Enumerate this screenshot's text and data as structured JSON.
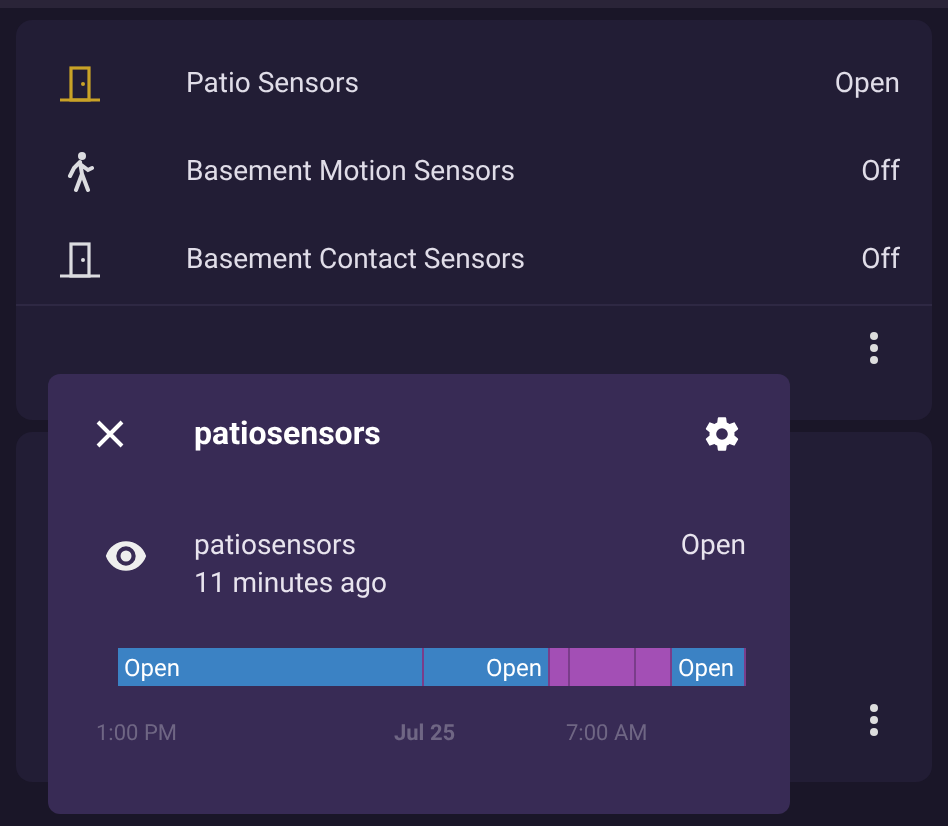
{
  "entities": [
    {
      "name": "Patio Sensors",
      "state": "Open",
      "kind": "door",
      "active": true
    },
    {
      "name": "Basement Motion Sensors",
      "state": "Off",
      "kind": "motion",
      "active": false
    },
    {
      "name": "Basement Contact Sensors",
      "state": "Off",
      "kind": "door",
      "active": false
    }
  ],
  "dialog": {
    "title": "patiosensors",
    "entity": {
      "name": "patiosensors",
      "time": "11 minutes ago",
      "state": "Open"
    },
    "timeline": [
      {
        "label": "Open",
        "color": "#3b82c4"
      },
      {
        "label": "Open",
        "color": "#3b82c4"
      },
      {
        "color": "#a34fb5"
      },
      {
        "color": "#a34fb5"
      },
      {
        "color": "#a34fb5"
      },
      {
        "label": "Open",
        "color": "#3b82c4"
      }
    ],
    "axis": [
      {
        "label": "1:00 PM",
        "bold": false
      },
      {
        "label": "Jul 25",
        "bold": true
      },
      {
        "label": "7:00 AM",
        "bold": false
      }
    ]
  }
}
